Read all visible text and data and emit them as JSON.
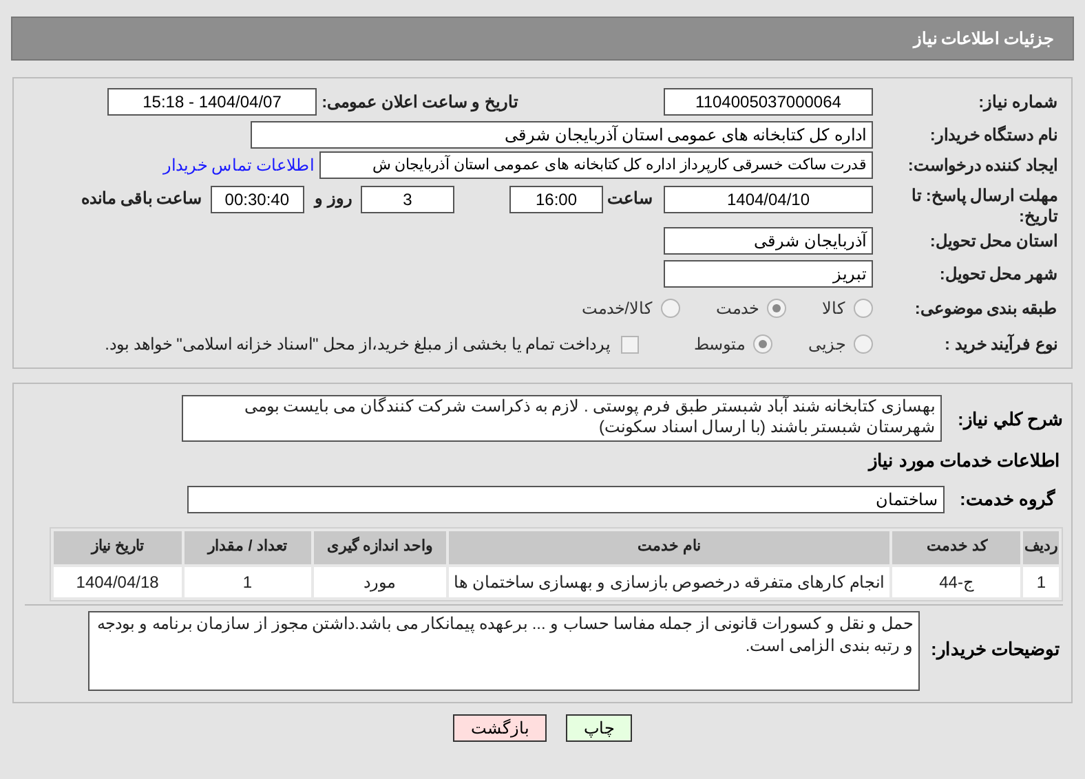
{
  "header": {
    "title": "جزئیات اطلاعات نیاز"
  },
  "need_number": {
    "label": "شماره نیاز:",
    "value": "1104005037000064"
  },
  "announce": {
    "label": "تاریخ و ساعت اعلان عمومی:",
    "value": "1404/04/07 - 15:18"
  },
  "buyer_org": {
    "label": "نام دستگاه خریدار:",
    "value": "اداره کل کتابخانه های عمومی استان آذربایجان شرقی"
  },
  "requester": {
    "label": "ایجاد کننده درخواست:",
    "value": "قدرت ساکت خسرقی کارپرداز اداره کل کتابخانه های عمومی استان آذربایجان ش",
    "link": "اطلاعات تماس خریدار"
  },
  "deadline": {
    "label": "مهلت ارسال پاسخ: تا تاریخ:",
    "date": "1404/04/10",
    "time_label": "ساعت",
    "time": "16:00",
    "days": "3",
    "days_label": "روز و",
    "remaining": "00:30:40",
    "remaining_label": "ساعت باقی مانده"
  },
  "province": {
    "label": "استان محل تحویل:",
    "value": "آذربایجان شرقی"
  },
  "city": {
    "label": "شهر محل تحویل:",
    "value": "تبریز"
  },
  "category": {
    "label": "طبقه بندی موضوعی:",
    "options": [
      {
        "label": "کالا",
        "selected": false
      },
      {
        "label": "خدمت",
        "selected": true
      },
      {
        "label": "کالا/خدمت",
        "selected": false
      }
    ]
  },
  "purchase_type": {
    "label": "نوع فرآیند خرید :",
    "options": [
      {
        "label": "جزیی",
        "selected": false
      },
      {
        "label": "متوسط",
        "selected": true
      }
    ],
    "checkbox": {
      "label": "پرداخت تمام یا بخشی از مبلغ خرید،از محل \"اسناد خزانه اسلامی\" خواهد بود.",
      "checked": false
    }
  },
  "description": {
    "label": "شرح کلي نياز:",
    "value": "بهسازی کتابخانه شند آباد شبستر طبق فرم پوستی . لازم به ذکراست شرکت کنندگان می بایست بومی شهرستان شبستر باشند (با ارسال اسناد سکونت)"
  },
  "services_heading": "اطلاعات خدمات مورد نیاز",
  "service_group": {
    "label": "گروه خدمت:",
    "value": "ساختمان"
  },
  "table": {
    "columns": [
      "ردیف",
      "کد خدمت",
      "نام خدمت",
      "واحد اندازه گیری",
      "تعداد / مقدار",
      "تاریخ نیاز"
    ],
    "rows": [
      [
        "1",
        "ج-44",
        "انجام کارهای متفرقه درخصوص بازسازی و بهسازی ساختمان ها",
        "مورد",
        "1",
        "1404/04/18"
      ]
    ]
  },
  "buyer_notes": {
    "label": "توضیحات خریدار:",
    "value": "حمل و نقل و کسورات قانونی از جمله مفاسا حساب و ... برعهده پیمانکار می باشد.داشتن مجوز از سازمان برنامه و بودجه و رتبه بندی الزامی است."
  },
  "buttons": [
    {
      "label": "چاپ",
      "kind": "print"
    },
    {
      "label": "بازگشت",
      "kind": "back"
    }
  ]
}
